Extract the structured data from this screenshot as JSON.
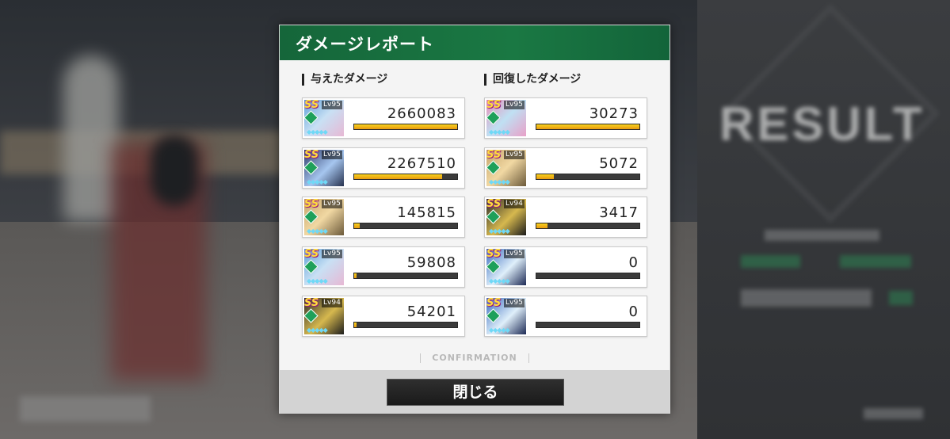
{
  "dialog": {
    "title": "ダメージレポート",
    "dealt_title": "与えたダメージ",
    "healed_title": "回復したダメージ",
    "confirmation": "CONFIRMATION",
    "close_label": "閉じる"
  },
  "dealt": [
    {
      "rank": "SS",
      "level": "Lv95",
      "value": "2660083",
      "fill": 1.0
    },
    {
      "rank": "SS",
      "level": "Lv95",
      "value": "2267510",
      "fill": 0.85
    },
    {
      "rank": "SS",
      "level": "Lv95",
      "value": "145815",
      "fill": 0.055
    },
    {
      "rank": "SS",
      "level": "Lv95",
      "value": "59808",
      "fill": 0.022
    },
    {
      "rank": "SS",
      "level": "Lv94",
      "value": "54201",
      "fill": 0.02
    }
  ],
  "healed": [
    {
      "rank": "SS",
      "level": "Lv95",
      "value": "30273",
      "fill": 1.0
    },
    {
      "rank": "SS",
      "level": "Lv95",
      "value": "5072",
      "fill": 0.17
    },
    {
      "rank": "SS",
      "level": "Lv94",
      "value": "3417",
      "fill": 0.11
    },
    {
      "rank": "SS",
      "level": "Lv95",
      "value": "0",
      "fill": 0
    },
    {
      "rank": "SS",
      "level": "Lv95",
      "value": "0",
      "fill": 0
    }
  ],
  "background": {
    "result_text": "RESULT"
  },
  "colors": {
    "header": "#15663a",
    "bar_fill": "#f7d21c",
    "bar_track": "#3b3b3b"
  }
}
